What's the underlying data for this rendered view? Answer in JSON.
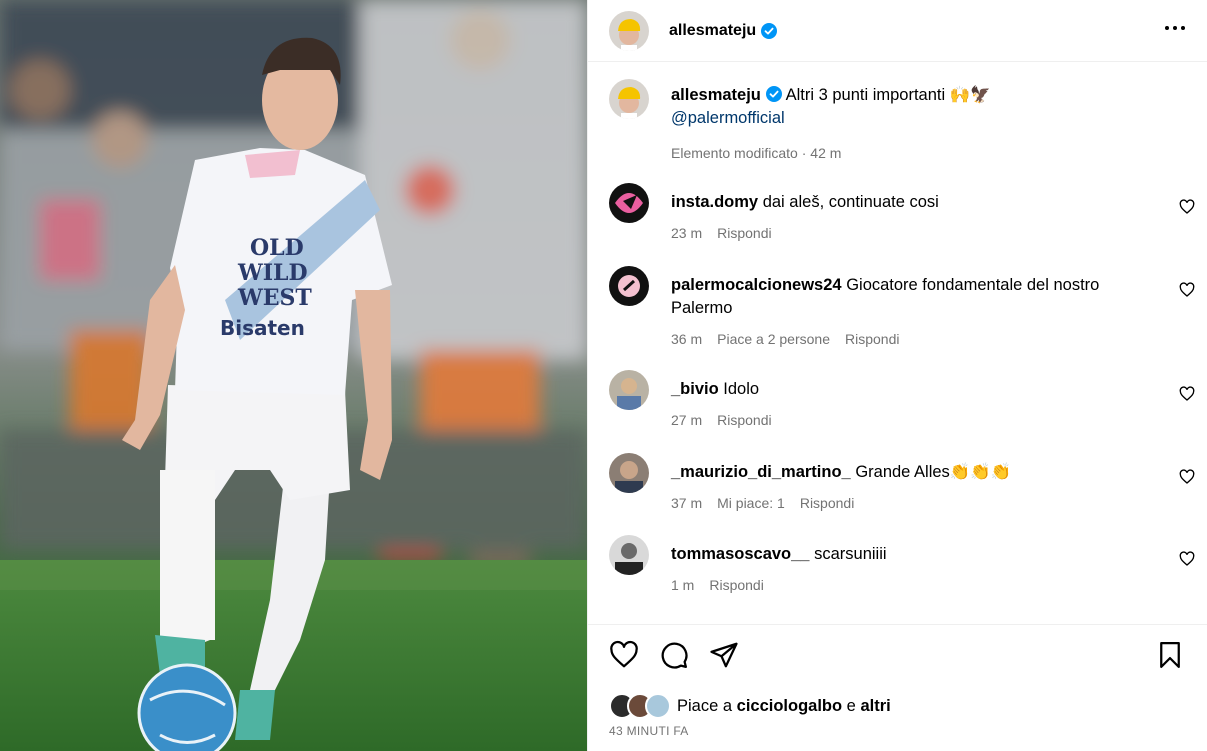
{
  "post": {
    "author": "allesmateju",
    "caption_text": "Altri 3 punti importanti",
    "caption_emojis": "🙌🦅",
    "mention": "@palermofficial",
    "edited_label": "Elemento modificato",
    "caption_age": "42 m"
  },
  "comments": [
    {
      "user": "insta.domy",
      "text": "dai aleš, continuate cosi",
      "age": "23 m",
      "likes": "",
      "reply": "Rispondi"
    },
    {
      "user": "palermocalcionews24",
      "text": "Giocatore fondamentale del nostro Palermo",
      "age": "36 m",
      "likes": "Piace a 2 persone",
      "reply": "Rispondi"
    },
    {
      "user": "_bivio",
      "text": "Idolo",
      "age": "27 m",
      "likes": "",
      "reply": "Rispondi"
    },
    {
      "user": "_maurizio_di_martino_",
      "text": "Grande Alles👏👏👏",
      "age": "37 m",
      "likes": "Mi piace: 1",
      "reply": "Rispondi"
    },
    {
      "user": "tommasoscavo__",
      "text": "scarsuniiii",
      "age": "1 m",
      "likes": "",
      "reply": "Rispondi"
    }
  ],
  "footer": {
    "likes_prefix": "Piace a",
    "likes_user": "cicciologalbo",
    "likes_and": "e",
    "likes_others": "altri",
    "timestamp": "43 MINUTI FA"
  },
  "icons": {
    "verified": "verified-badge-icon",
    "more": "more-options-icon",
    "like": "heart-icon",
    "comment": "comment-bubble-icon",
    "share": "paper-plane-icon",
    "save": "bookmark-icon"
  },
  "colors": {
    "verified": "#0095f6",
    "mention": "#00376b",
    "secondary_text": "#737373",
    "divider": "#efefef"
  }
}
